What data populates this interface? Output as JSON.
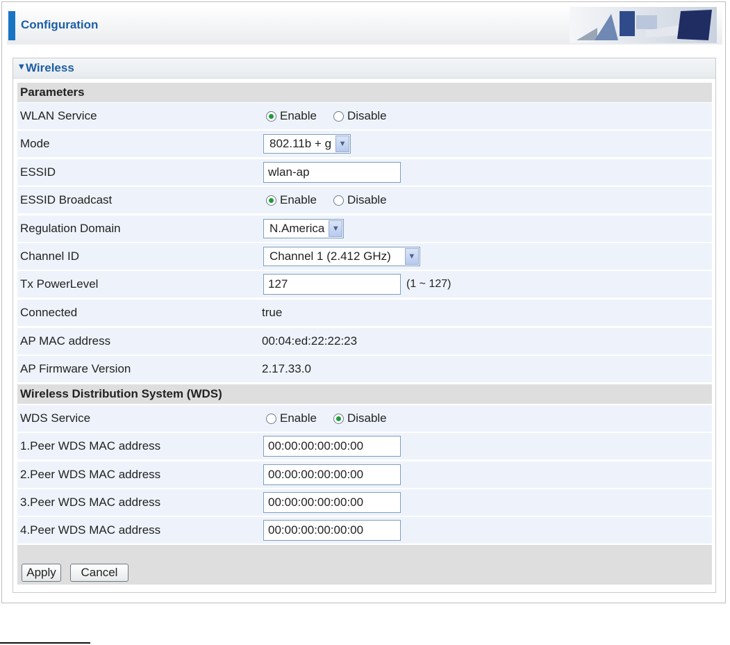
{
  "header": {
    "title": "Configuration",
    "image_icon": "office-illustration-icon"
  },
  "panel": {
    "title": "Wireless"
  },
  "sections": {
    "parameters": "Parameters",
    "wds": "Wireless Distribution System (WDS)"
  },
  "fields": {
    "wlan_service": {
      "label": "WLAN Service",
      "enable": "Enable",
      "disable": "Disable",
      "selected": "Enable"
    },
    "mode": {
      "label": "Mode",
      "value": "802.11b + g"
    },
    "essid": {
      "label": "ESSID",
      "value": "wlan-ap"
    },
    "essid_broadcast": {
      "label": "ESSID Broadcast",
      "enable": "Enable",
      "disable": "Disable",
      "selected": "Enable"
    },
    "regulation_domain": {
      "label": "Regulation Domain",
      "value": "N.America"
    },
    "channel_id": {
      "label": "Channel ID",
      "value": "Channel 1 (2.412 GHz)"
    },
    "tx_power": {
      "label": "Tx PowerLevel",
      "value": "127",
      "hint": "(1 ~ 127)"
    },
    "connected": {
      "label": "Connected",
      "value": "true"
    },
    "ap_mac": {
      "label": "AP MAC address",
      "value": "00:04:ed:22:22:23"
    },
    "ap_firmware": {
      "label": "AP Firmware Version",
      "value": "2.17.33.0"
    },
    "wds_service": {
      "label": "WDS Service",
      "enable": "Enable",
      "disable": "Disable",
      "selected": "Disable"
    },
    "peer1": {
      "label": "1.Peer WDS MAC address",
      "value": "00:00:00:00:00:00"
    },
    "peer2": {
      "label": "2.Peer WDS MAC address",
      "value": "00:00:00:00:00:00"
    },
    "peer3": {
      "label": "3.Peer WDS MAC address",
      "value": "00:00:00:00:00:00"
    },
    "peer4": {
      "label": "4.Peer WDS MAC address",
      "value": "00:00:00:00:00:00"
    }
  },
  "buttons": {
    "apply": "Apply",
    "cancel": "Cancel"
  },
  "colors": {
    "accent": "#1a74c4",
    "title_blue": "#1d5fa3",
    "row_bg": "#eef3fb",
    "section_bg": "#dedede"
  }
}
